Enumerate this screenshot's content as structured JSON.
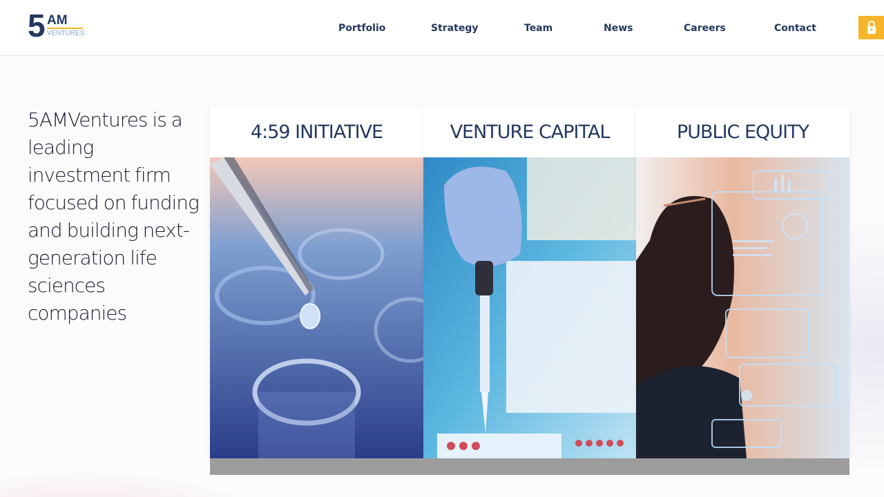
{
  "brand": {
    "logo_number": "5",
    "logo_letters": "AM",
    "logo_sub": "VENTURES",
    "colors": {
      "navy": "#24385f",
      "gold": "#f7b52a",
      "light_blue": "#8aa4c8"
    }
  },
  "nav": {
    "items": [
      {
        "label": "Portfolio"
      },
      {
        "label": "Strategy"
      },
      {
        "label": "Team"
      },
      {
        "label": "News"
      },
      {
        "label": "Careers"
      },
      {
        "label": "Contact"
      }
    ],
    "login_icon": "lock-icon"
  },
  "hero": {
    "tagline": "5AMVentures is a leading investment firm focused on funding and building next-generation life sciences companies"
  },
  "cards": [
    {
      "title": "4:59 INITIATIVE",
      "image": "pipette-droplet-test-tubes"
    },
    {
      "title": "VENTURE CAPITAL",
      "image": "gloved-hand-pipette-well-plate"
    },
    {
      "title": "PUBLIC EQUITY",
      "image": "person-with-holographic-data-screens"
    }
  ]
}
